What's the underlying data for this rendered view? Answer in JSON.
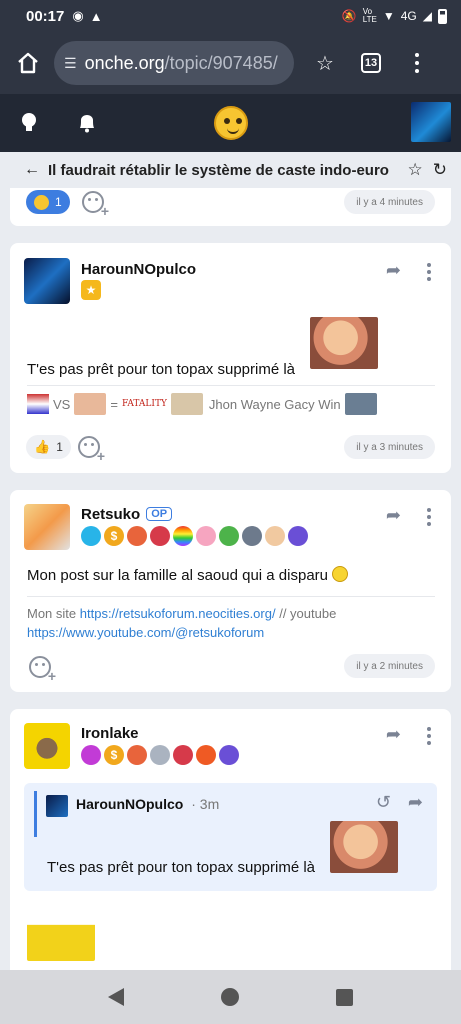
{
  "status": {
    "time": "00:17",
    "net": "Vo\nLTE",
    "signal": "4G"
  },
  "browser": {
    "url_host": "onche.org",
    "url_path": "/topic/907485/",
    "tab_count": "13"
  },
  "topic": {
    "title": "Il faudrait rétablir le système de caste indo-euro"
  },
  "posts": [
    {
      "reaction_count": "1",
      "time": "il y a 4 minutes"
    },
    {
      "username": "HarounNOpulco",
      "message": "T'es pas prêt pour ton topax supprimé là",
      "sig_text": "VS",
      "sig_eq": "=",
      "sig_fatality": "FATALITY",
      "sig_tail": "Jhon Wayne Gacy Win",
      "reaction_count": "1",
      "time": "il y a 3 minutes"
    },
    {
      "username": "Retsuko",
      "op_label": "OP",
      "message": "Mon post sur la famille al saoud qui a disparu",
      "sig_prefix": "Mon site",
      "sig_link1": "https://retsukoforum.neocities.org/",
      "sig_mid": "// youtube",
      "sig_link2": "https://www.youtube.com/@retsukoforum",
      "time": "il y a 2 minutes"
    },
    {
      "username": "Ironlake",
      "quote_user": "HarounNOpulco",
      "quote_time": "· 3m",
      "quote_message": "T'es pas prêt pour ton topax supprimé là"
    }
  ],
  "colors": {
    "chrome": "#2f3542",
    "site_header": "#222834",
    "accent": "#3d7de0"
  }
}
